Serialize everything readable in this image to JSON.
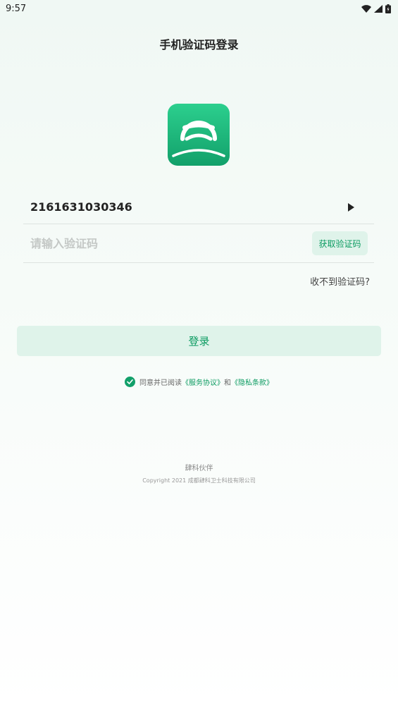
{
  "status_bar": {
    "time": "9:57",
    "icons": [
      "wifi-icon",
      "signal-icon",
      "battery-icon"
    ]
  },
  "header": {
    "title": "手机验证码登录"
  },
  "logo": {
    "icon": "steering-wheel-icon",
    "color_top": "#2ccf8e",
    "color_bottom": "#12a06a"
  },
  "form": {
    "phone_value": "2161631030346",
    "code_placeholder": "请输入验证码",
    "code_value": "",
    "get_code_label": "获取验证码",
    "no_code_label": "收不到验证码?"
  },
  "login": {
    "label": "登录"
  },
  "agreement": {
    "checked": true,
    "prefix": "同意并已阅读",
    "service_link": "《服务协议》",
    "and_text": "和",
    "privacy_link": "《隐私条款》"
  },
  "footer": {
    "brand": "肆科伙伴",
    "copyright": "Copyright  2021  成都肆科卫士科技有限公司"
  },
  "colors": {
    "accent": "#0b9b61",
    "button_bg": "#dff3ea"
  }
}
